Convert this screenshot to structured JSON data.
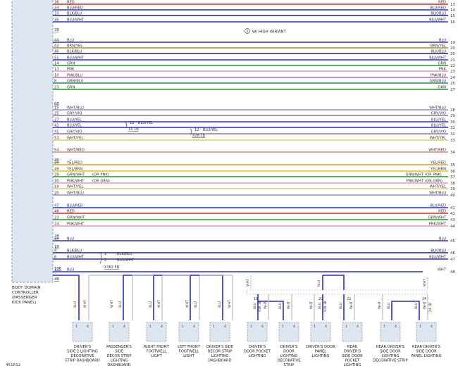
{
  "note": {
    "number": "1",
    "text": "W/ HIGH VARIANT"
  },
  "module": {
    "name_lines": [
      "BODY DOMAIN",
      "CONTROLLER",
      "(PASSENGER",
      "KICK PANEL)"
    ]
  },
  "figure_id": "451612",
  "wires": [
    {
      "pin": "36",
      "label": "RED",
      "right_label": "RED",
      "row": "13",
      "color": "#e02020"
    },
    {
      "pin": "34",
      "label": "BLU/RED",
      "right_label": "BLU/RED",
      "row": "14",
      "color": "#2a2ad6"
    },
    {
      "pin": "33",
      "label": "BLK/BLU",
      "right_label": "BLK/BLU",
      "row": "15",
      "color": "#1a1a8c"
    },
    {
      "pin": "35",
      "label": "BLU/WHT",
      "right_label": "BLU/WHT",
      "row": "16",
      "color": "#2a2ad6"
    },
    {
      "pin": "44",
      "label": "BLU",
      "right_label": "BLU",
      "row": "19",
      "color": "#2a2ad6"
    },
    {
      "pin": "43",
      "label": "BRN/YEL",
      "right_label": "BRN/YEL",
      "row": "20",
      "color": "#b08a1a"
    },
    {
      "pin": "46",
      "label": "BLK/BLU",
      "right_label": "BLK/BLU",
      "row": "20",
      "color": "#1a1a8c"
    },
    {
      "pin": "51",
      "label": "BLU/WHT",
      "right_label": "BLU/WHT",
      "row": "21",
      "color": "#2a2ad6"
    },
    {
      "pin": "14",
      "label": "GRN",
      "right_label": "GRN",
      "row": "22",
      "color": "#1f9a1f"
    },
    {
      "pin": "13",
      "label": "PNK",
      "right_label": "PNK",
      "row": "23",
      "color": "#f090c0"
    },
    {
      "pin": "10",
      "label": "PNK/BLU",
      "right_label": "PNK/BLU",
      "row": "24",
      "color": "#c06ac0"
    },
    {
      "pin": "8",
      "label": "GRN/BLU",
      "right_label": "GRN/BLU",
      "row": "25",
      "color": "#1f8a6a"
    },
    {
      "pin": "23",
      "label": "GRN",
      "right_label": "GRN",
      "row": "27",
      "color": "#1f9a1f"
    },
    {
      "pin": "15",
      "label": "WHT/BLU",
      "right_label": "WHT/BLU",
      "row": "28",
      "color": "#8c8cd8"
    },
    {
      "pin": "25",
      "label": "GRY/VIO",
      "right_label": "GRY/VIO",
      "row": "29",
      "color": "#9a6ab0"
    },
    {
      "pin": "27",
      "label": "BLU/YEL",
      "right_label": "BLU/YEL",
      "row": "30",
      "color": "#2a2ad6"
    },
    {
      "pin": "42",
      "label": "BLU/YEL",
      "right_label": "BLU/YEL",
      "row": "31",
      "color": "#2a2ad6"
    },
    {
      "pin": "41",
      "label": "GRY/VIO",
      "right_label": "GRY/VIO",
      "row": "32",
      "color": "#9a6ab0"
    },
    {
      "pin": "53",
      "label": "WHT/YEL",
      "right_label": "WHT/YEL",
      "row": "33",
      "color": "#d8d060"
    },
    {
      "pin": "54",
      "label": "WHT/RED",
      "right_label": "WHT/RED",
      "row": "34",
      "color": "#e88080"
    },
    {
      "pin": "20",
      "label": "YEL/RED",
      "right_label": "YEL/RED",
      "row": "35",
      "color": "#e8a020"
    },
    {
      "pin": "49",
      "label": "YEL/BRN",
      "right_label": "YEL/BRN",
      "row": "36",
      "color": "#e0c020"
    },
    {
      "pin": "29",
      "label": "GRN/WHT",
      "right_label": "GRN/WHT",
      "mid_left": "(OR PNK)",
      "mid_right": "(OR PNK)",
      "row": "37",
      "color": "#1f9a1f"
    },
    {
      "pin": "30",
      "label": "PNK/WHT",
      "right_label": "PNK/WHT",
      "mid_left": "(OR GRN)",
      "mid_right": "(OR GRN)",
      "row": "38",
      "color": "#f090c0"
    },
    {
      "pin": "19",
      "label": "WHT/YEL",
      "right_label": "WHT/YEL",
      "row": "39",
      "color": "#d8d060"
    },
    {
      "pin": "20",
      "label": "WHT/BLU",
      "right_label": "WHT/BLU",
      "row": "40",
      "color": "#8c8cd8"
    },
    {
      "pin": "47",
      "label": "BLU/RED",
      "right_label": "BLU/RED",
      "row": "41",
      "color": "#2a2ad6"
    },
    {
      "pin": "48",
      "label": "RED",
      "right_label": "RED",
      "row": "42",
      "color": "#e02020"
    },
    {
      "pin": "23",
      "label": "GRN/WHT",
      "right_label": "GRN/WHT",
      "row": "43",
      "color": "#1f9a1f"
    },
    {
      "pin": "24",
      "label": "PNK/WHT",
      "right_label": "PNK/WHT",
      "row": "44",
      "color": "#f090c0"
    },
    {
      "pin": "18",
      "label": "BLU",
      "right_label": "BLU",
      "row": "45",
      "color": "#2a2ad6"
    },
    {
      "pin": "4",
      "label": "BLK/BLU",
      "right_label": "BLK/BLU",
      "row": "46",
      "color": "#1a1a8c"
    },
    {
      "pin": "6",
      "label": "BLU/WHT",
      "right_label": "BLU/WHT",
      "row": "47",
      "color": "#2a2ad6"
    },
    {
      "pin": "17",
      "label": "BLU",
      "right_label": "WHT",
      "row": "48",
      "color": "#2a2ad6"
    }
  ],
  "connector_labels": [
    "7B",
    "6B",
    "4B",
    "2B",
    "1B",
    "10B",
    "4B"
  ],
  "inline": [
    {
      "pin": "12",
      "label": "BLU/YEL",
      "connector": "X5 1B"
    },
    {
      "pin": "12",
      "label": "BLU/YEL",
      "connector": "X28 1B"
    },
    {
      "pin": "1",
      "label": "BLK/BLU"
    },
    {
      "pin": "2",
      "label": "BLU/WHT",
      "connector": "X382 5B"
    }
  ],
  "branch_labels": {
    "blu": "BLU",
    "wht": "WHT",
    "pin19": "19",
    "pin20": "20",
    "pin23": "23",
    "pin24": "24",
    "x26_1b": "X26 1B",
    "x28_1b": "X28 1B",
    "x4_1b": "X4 1B"
  },
  "components": [
    {
      "name_lines": [
        "DRIVER'S",
        "SIDE 2 LIGHTING",
        "DECORATIVE",
        "STRIP DASHBOARD"
      ]
    },
    {
      "name_lines": [
        "PASSENGER'S",
        "SIDE",
        "DECOR STRIP",
        "LIGHTING",
        "DASHBOARD"
      ]
    },
    {
      "name_lines": [
        "RIGHT FRONT",
        "FOOTWELL",
        "LIGHT"
      ]
    },
    {
      "name_lines": [
        "LEFT FRONT",
        "FOOTWELL",
        "LIGHT"
      ]
    },
    {
      "name_lines": [
        "DRIVER'S SIDE",
        "DECOR STRIP",
        "LIGHTING",
        "DASHBOARD"
      ]
    },
    {
      "name_lines": [
        "DRIVER'S",
        "DOOR POCKET",
        "LIGHTING"
      ]
    },
    {
      "name_lines": [
        "DRIVER'S",
        "DOOR",
        "LIGHTING",
        "DECORATIVE",
        "STRIP"
      ]
    },
    {
      "name_lines": [
        "DRIVER'S DOOR",
        "PANEL",
        "LIGHTING"
      ]
    },
    {
      "name_lines": [
        "REAR",
        "DRIVER'S",
        "SIDE DOOR",
        "POCKET",
        "LIGHTING"
      ]
    },
    {
      "name_lines": [
        "REAR DRIVER'S",
        "SIDE DOOR",
        "LIGHTING",
        "DECORATIVE STRIP"
      ]
    },
    {
      "name_lines": [
        "REAR DRIVER'S",
        "SIDE DOOR",
        "PANEL LIGHTING"
      ]
    }
  ],
  "component_pins": {
    "left": "1",
    "right": "4"
  }
}
